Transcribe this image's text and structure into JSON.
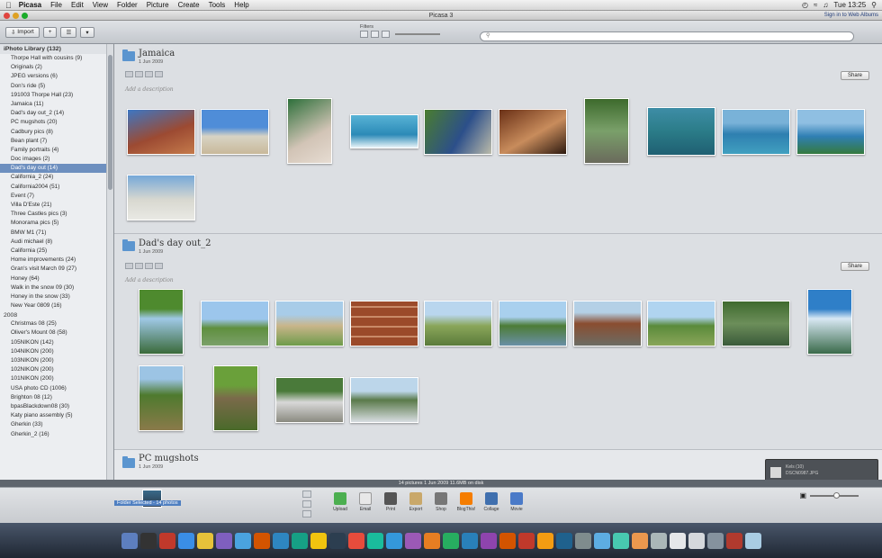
{
  "menubar": {
    "app": "Picasa",
    "items": [
      "File",
      "Edit",
      "View",
      "Folder",
      "Picture",
      "Create",
      "Tools",
      "Help"
    ],
    "clock": "Tue 13:25"
  },
  "window": {
    "title": "Picasa 3",
    "signin": "Sign in to Web Albums"
  },
  "toolbar": {
    "import_label": "Import",
    "filters_label": "Filters"
  },
  "sidebar": {
    "group": "iPhoto Library (132)",
    "items": [
      "Thorpe Hall with cousins (9)",
      "Originals (2)",
      "JPEG versions (6)",
      "Don's ride (5)",
      "191003 Thorpe Hall (23)",
      "Jamaica (11)",
      "Dad's day out_2 (14)",
      "PC mugshots (20)",
      "Cadbury pics (8)",
      "Bean plant (7)",
      "Family portraits (4)",
      "Doc images (2)",
      "Dad's day out (14)",
      "California_2 (24)",
      "California2004 (51)",
      "Event (7)",
      "Villa D'Este (21)",
      "Three Castles pics (3)",
      "Monorama pics (5)",
      "BMW M1 (71)",
      "Audi michael (8)",
      "California (25)",
      "Home improvements (24)",
      "Gran's visit March 09 (27)",
      "Honey (64)",
      "Walk in the snow 09 (30)",
      "Honey in the snow (33)",
      "New Year 0809 (16)"
    ],
    "selected_index": 12,
    "year": "2008",
    "items2008": [
      "Christmas 08 (25)",
      "Oliver's Mount 08 (58)",
      "105NIKON (142)",
      "104NIKON (200)",
      "103NIKON (200)",
      "102NIKON (200)",
      "101NIKON (200)",
      "USA photo CD (1006)",
      "Brighton 08 (12)",
      "bpasBlackdown08 (30)",
      "Katy piano assembly (5)",
      "Gherkin (33)",
      "Gherkin_2 (16)"
    ]
  },
  "albums": [
    {
      "title": "Jamaica",
      "date": "1 Jun 2009",
      "description": "Add a description",
      "share": "Share"
    },
    {
      "title": "Dad's day out_2",
      "date": "1 Jun 2009",
      "description": "Add a description",
      "share": "Share"
    },
    {
      "title": "PC mugshots",
      "date": "1 Jun 2009"
    }
  ],
  "status": "14 pictures   1 Jun 2009   11.6MB on disk",
  "tray": {
    "selection": "Folder Selected - 14 photos",
    "actions": [
      "Upload",
      "Email",
      "Print",
      "Export",
      "Shop",
      "BlogThis!",
      "Collage",
      "Movie"
    ]
  },
  "notification": {
    "line1": "Kels (10)",
    "line2": "DSCN0987.JPG"
  }
}
